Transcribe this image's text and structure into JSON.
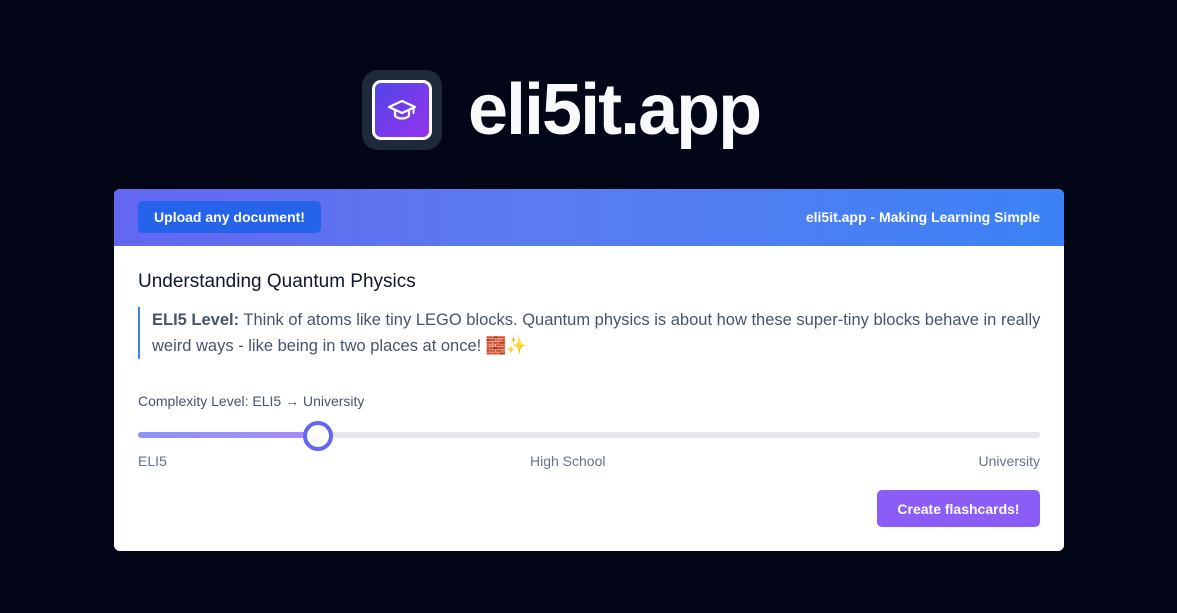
{
  "brand": {
    "name": "eli5it.app",
    "logo_icon": "graduation-cap-icon"
  },
  "header": {
    "upload_label": "Upload any document!",
    "tagline": "eli5it.app - Making Learning Simple"
  },
  "content": {
    "title": "Understanding Quantum Physics",
    "eli5_label": "ELI5 Level:",
    "eli5_text": "Think of atoms like tiny LEGO blocks. Quantum physics is about how these super-tiny blocks behave in really weird ways - like being in two places at once! 🧱✨"
  },
  "complexity": {
    "label": "Complexity Level: ELI5 → University",
    "value": 0.2,
    "ticks": [
      "ELI5",
      "High School",
      "University"
    ]
  },
  "actions": {
    "flashcards_label": "Create flashcards!"
  },
  "colors": {
    "background": "#020617",
    "accent_indigo": "#6366f1",
    "accent_blue": "#3b82f6",
    "button_purple": "#8b5cf6"
  }
}
